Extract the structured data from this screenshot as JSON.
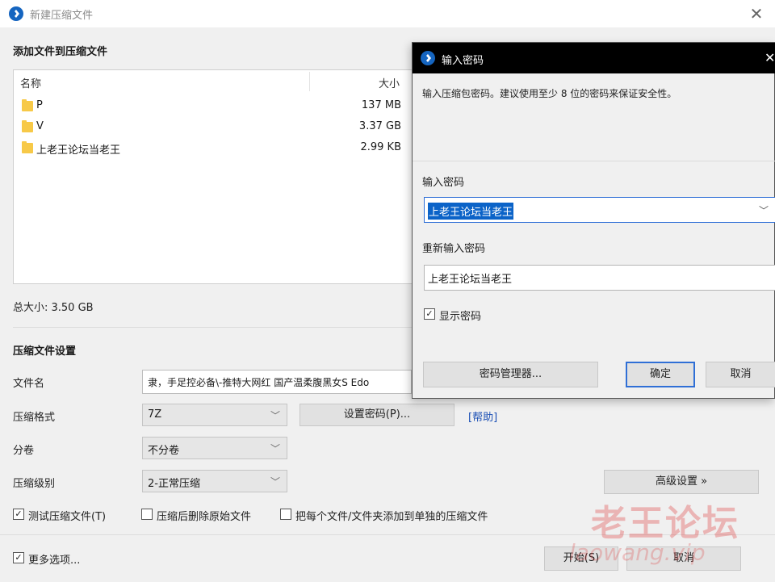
{
  "main_window": {
    "title": "新建压缩文件",
    "close_glyph": "✕",
    "add_section_title": "添加文件到压缩文件",
    "file_list": {
      "columns": {
        "name": "名称",
        "size": "大小"
      },
      "rows": [
        {
          "name": "P",
          "size": "137 MB"
        },
        {
          "name": "V",
          "size": "3.37 GB"
        },
        {
          "name": "上老王论坛当老王",
          "size": "2.99 KB"
        }
      ]
    },
    "total_size": "总大小: 3.50 GB",
    "settings_title": "压缩文件设置",
    "filename_label": "文件名",
    "filename_value": "隶，手足控必备\\-推特大网红 国产温柔腹黑女S Edo",
    "format_label": "压缩格式",
    "format_value": "7Z",
    "set_password_button": "设置密码(P)...",
    "help_link": "[帮助]",
    "split_label": "分卷",
    "split_value": "不分卷",
    "level_label": "压缩级别",
    "level_value": "2-正常压缩",
    "advanced_button": "高级设置 »",
    "checkbox_test": "测试压缩文件(T)",
    "checkbox_test_checked": true,
    "checkbox_delete": "压缩后删除原始文件",
    "checkbox_delete_checked": false,
    "checkbox_each": "把每个文件/文件夹添加到单独的压缩文件",
    "checkbox_each_checked": false,
    "checkbox_more": "更多选项...",
    "checkbox_more_checked": true,
    "start_button": "开始(S)",
    "cancel_button": "取消"
  },
  "password_dialog": {
    "title": "输入密码",
    "close_glyph": "✕",
    "description": "输入压缩包密码。建议使用至少 8 位的密码来保证安全性。",
    "password_label": "输入密码",
    "password_value": "上老王论坛当老王",
    "reenter_label": "重新输入密码",
    "reenter_value": "上老王论坛当老王",
    "show_password_label": "显示密码",
    "show_password_checked": true,
    "manager_button": "密码管理器...",
    "ok_button": "确定",
    "cancel_button": "取消"
  },
  "watermark": {
    "text": "老王论坛",
    "url": "laowang.vip"
  },
  "colors": {
    "accent": "#2f6fd6",
    "selection": "#0b63c8",
    "folder": "#f7c948"
  }
}
